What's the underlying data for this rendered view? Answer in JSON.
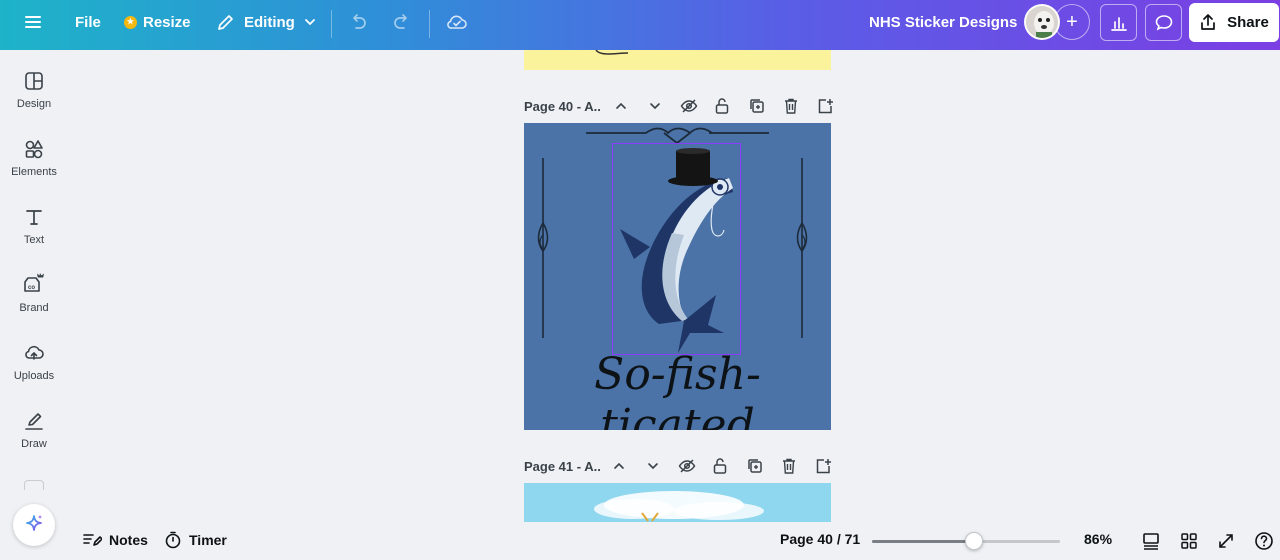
{
  "topbar": {
    "file_label": "File",
    "resize_label": "Resize",
    "editing_label": "Editing",
    "project_title": "NHS Sticker Designs",
    "share_label": "Share",
    "gradient_colors": [
      "#1eb3c9",
      "#5a5de6",
      "#7b3fe4"
    ]
  },
  "sidebar": {
    "items": [
      {
        "label": "Design",
        "icon": "design-icon"
      },
      {
        "label": "Elements",
        "icon": "elements-icon"
      },
      {
        "label": "Text",
        "icon": "text-icon"
      },
      {
        "label": "Brand",
        "icon": "brand-icon"
      },
      {
        "label": "Uploads",
        "icon": "uploads-icon"
      },
      {
        "label": "Draw",
        "icon": "draw-icon"
      }
    ]
  },
  "canvas": {
    "page40_label": "Page 40 - A..",
    "page41_label": "Page 41 - A..",
    "sticker_text": "So-fish-ticated",
    "sticker_bg": "#4b73a7",
    "prev_page_color": "#fbf29c",
    "next_page_color": "#8fd7ef",
    "selection_color": "#8b3dff"
  },
  "bottombar": {
    "notes_label": "Notes",
    "timer_label": "Timer",
    "page_indicator": "Page 40 / 71",
    "zoom_label": "86%",
    "zoom_fraction": 0.54
  }
}
